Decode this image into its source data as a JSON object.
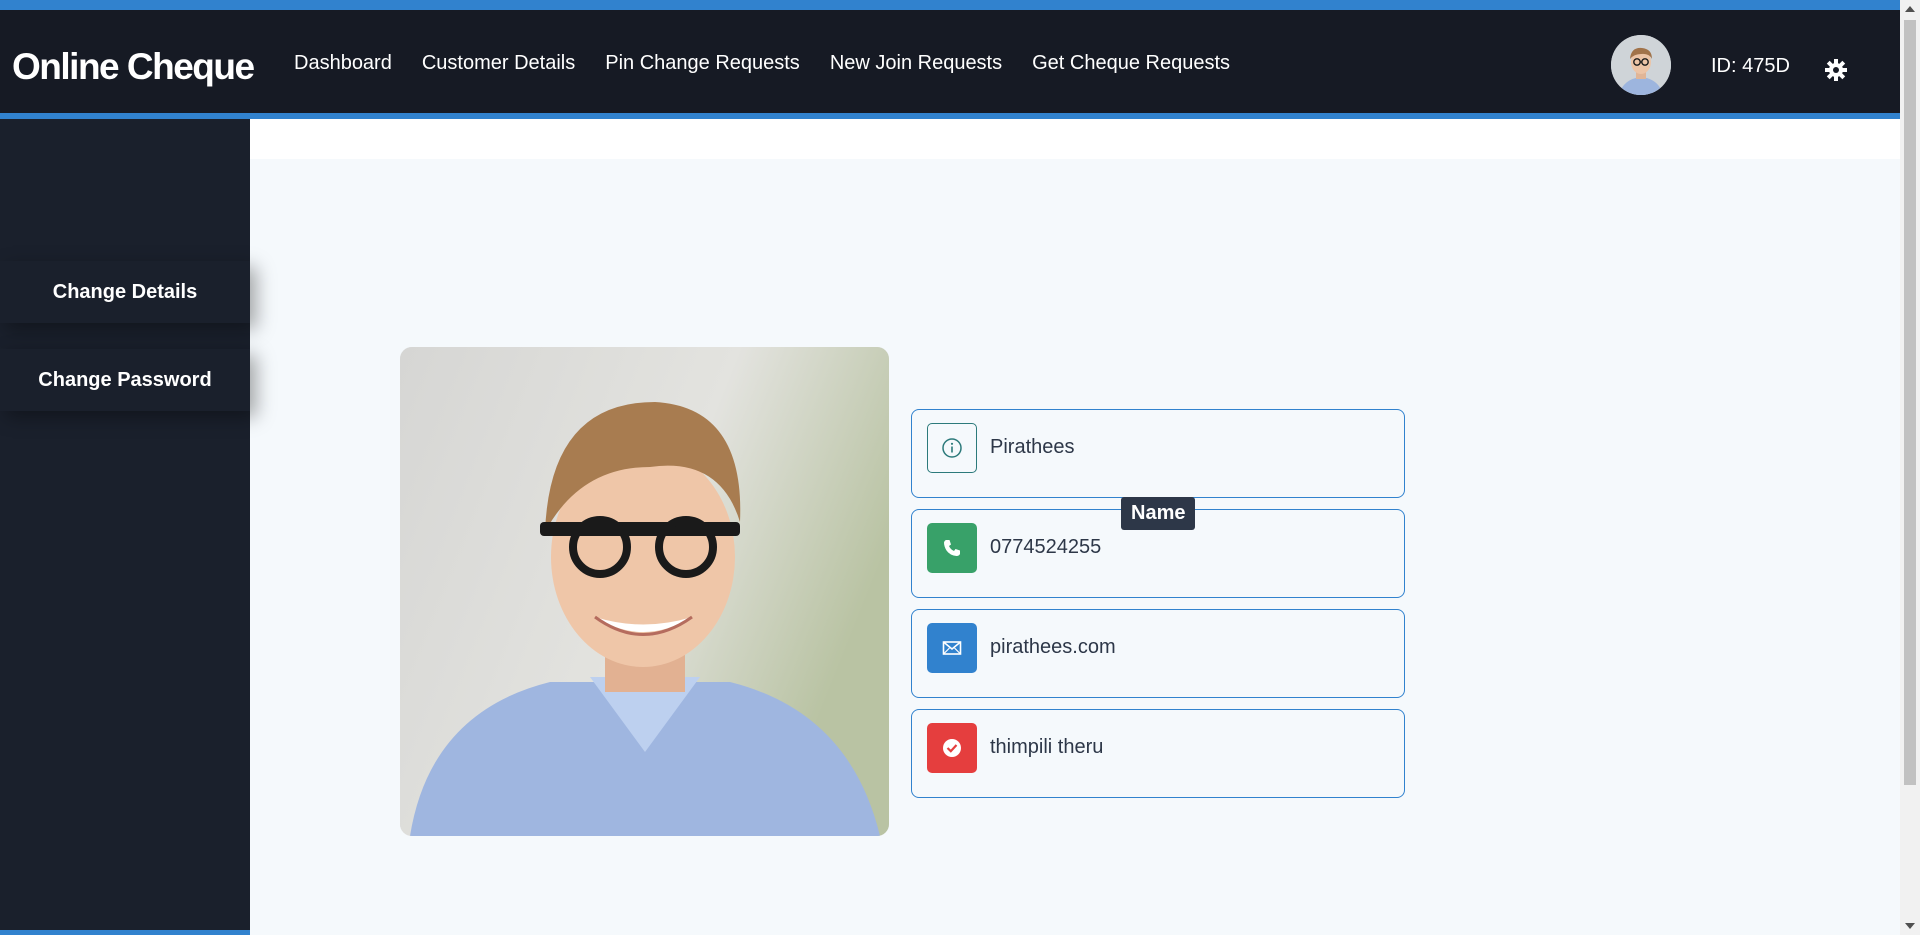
{
  "app": {
    "brand": "Online Cheque"
  },
  "nav": {
    "items": [
      {
        "label": "Dashboard"
      },
      {
        "label": "Customer Details"
      },
      {
        "label": "Pin Change Requests"
      },
      {
        "label": "New Join Requests"
      },
      {
        "label": "Get Cheque Requests"
      }
    ]
  },
  "user": {
    "id_label": "ID: 475D"
  },
  "sidebar": {
    "buttons": [
      {
        "label": "Change Details"
      },
      {
        "label": "Change Password"
      }
    ]
  },
  "profile": {
    "fields": [
      {
        "value": "Pirathees",
        "icon": "info-icon"
      },
      {
        "value": "0774524255",
        "icon": "phone-icon"
      },
      {
        "value": "pirathees.com",
        "icon": "mail-icon"
      },
      {
        "value": "thimpili theru",
        "icon": "check-icon"
      }
    ],
    "tooltip": "Name"
  },
  "colors": {
    "accent": "#3182ce",
    "header_bg": "#161a24",
    "sidebar_bg": "#1a202c",
    "phone_icon_bg": "#38a169",
    "mail_icon_bg": "#3182ce",
    "check_icon_bg": "#e53e3e"
  }
}
